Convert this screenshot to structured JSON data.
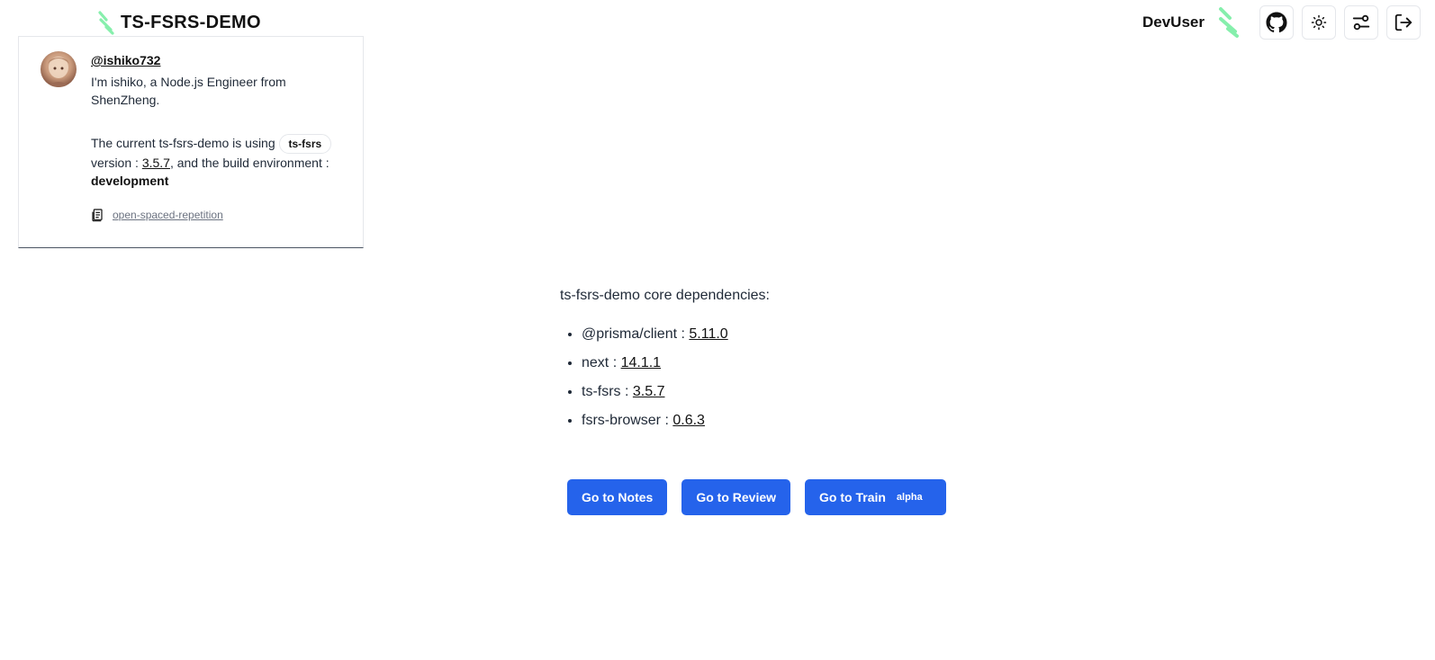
{
  "header": {
    "brand_title": "TS-FSRS-DEMO",
    "username": "DevUser",
    "icons": [
      "brand-logo-icon",
      "github-icon",
      "sun-icon",
      "sliders-icon",
      "logout-icon"
    ]
  },
  "card": {
    "handle": "@ishiko732",
    "bio": "I'm ishiko, a Node.js Engineer from ShenZheng.",
    "version_prefix": "The current ts-fsrs-demo is using",
    "package_pill": "ts-fsrs",
    "version_mid": "version :",
    "version_value": "3.5.7",
    "env_mid": ", and the build environment :",
    "env_value": "development",
    "repo_link": "open-spaced-repetition"
  },
  "main": {
    "heading": "ts-fsrs-demo core dependencies:",
    "dependencies": [
      {
        "name": "@prisma/client :",
        "version": "5.11.0"
      },
      {
        "name": "next :",
        "version": "14.1.1"
      },
      {
        "name": "ts-fsrs :",
        "version": "3.5.7"
      },
      {
        "name": "fsrs-browser :",
        "version": "0.6.3"
      }
    ],
    "buttons": {
      "notes": "Go to Notes",
      "review": "Go to Review",
      "train": "Go to Train",
      "train_badge": "alpha"
    }
  },
  "colors": {
    "primary": "#2563eb",
    "logo_green": "#86efac"
  }
}
